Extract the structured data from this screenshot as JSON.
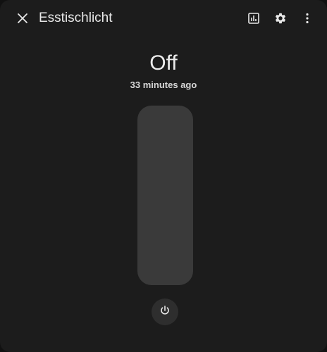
{
  "dialog": {
    "title": "Esstischlicht"
  },
  "header": {
    "close_icon": "close-icon",
    "history_icon": "history-chart-icon",
    "settings_icon": "gear-icon",
    "more_icon": "more-vert-icon"
  },
  "entity": {
    "state": "Off",
    "last_changed": "33 minutes ago",
    "switch_on": false
  },
  "controls": {
    "power_icon": "power-icon"
  },
  "colors": {
    "background": "#1c1c1c",
    "track": "#3a3a3a",
    "power_button": "#2e2e2e",
    "text": "#e1e1e1"
  }
}
